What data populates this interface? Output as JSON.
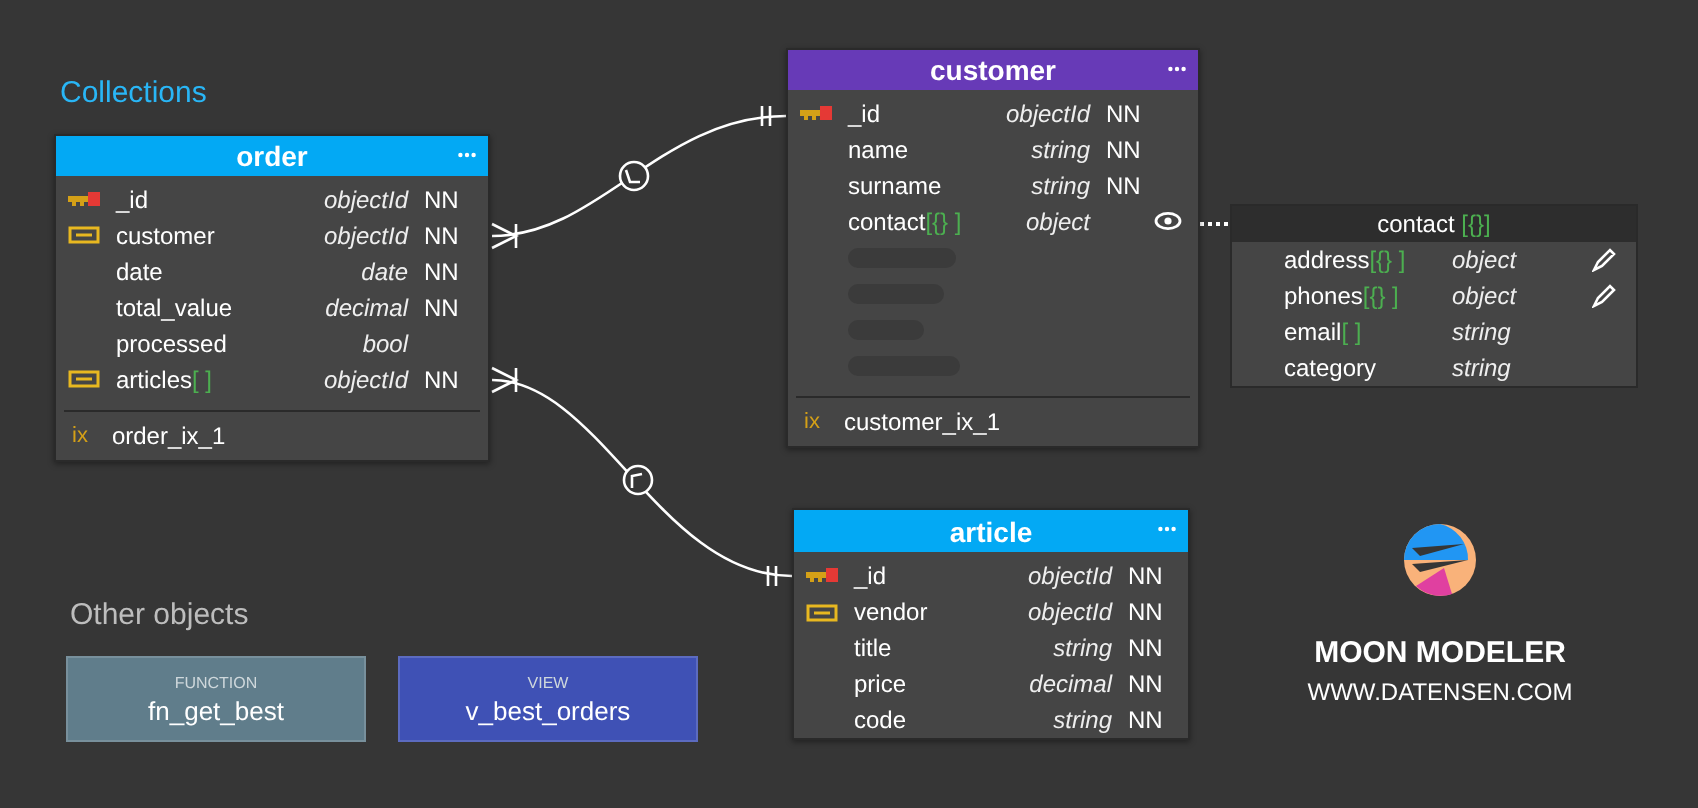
{
  "collections_label": "Collections",
  "tables": [
    {
      "name": "order",
      "color": "#03a9f4",
      "fields": [
        {
          "kind": "primary_key",
          "name": "_id",
          "type": "objectId",
          "nn": "NN"
        },
        {
          "kind": "foreign_key",
          "name": "customer",
          "type": "objectId",
          "nn": "NN"
        },
        {
          "kind": "plain",
          "name": "date",
          "type": "date",
          "nn": "NN"
        },
        {
          "kind": "plain",
          "name": "total_value",
          "type": "decimal",
          "nn": "NN"
        },
        {
          "kind": "plain",
          "name": "processed",
          "type": "bool"
        },
        {
          "kind": "foreign_key",
          "name": "articles",
          "suffix": "[ ]",
          "type": "objectId",
          "nn": "NN"
        }
      ],
      "indexes": [
        {
          "label": "ix",
          "name": "order_ix_1"
        }
      ]
    },
    {
      "name": "customer",
      "color": "#673ab7",
      "fields": [
        {
          "kind": "primary_key",
          "name": "_id",
          "type": "objectId",
          "nn": "NN"
        },
        {
          "kind": "plain",
          "name": "name",
          "type": "string",
          "nn": "NN"
        },
        {
          "kind": "plain",
          "name": "surname",
          "type": "string",
          "nn": "NN"
        },
        {
          "kind": "embedded",
          "name": "contact",
          "suffix": "[{} ]",
          "type": "object"
        }
      ],
      "indexes": [
        {
          "label": "ix",
          "name": "customer_ix_1"
        }
      ]
    },
    {
      "name": "article",
      "color": "#03a9f4",
      "fields": [
        {
          "kind": "primary_key",
          "name": "_id",
          "type": "objectId",
          "nn": "NN"
        },
        {
          "kind": "foreign_key",
          "name": "vendor",
          "type": "objectId",
          "nn": "NN"
        },
        {
          "kind": "plain",
          "name": "title",
          "type": "string",
          "nn": "NN"
        },
        {
          "kind": "plain",
          "name": "price",
          "type": "decimal",
          "nn": "NN"
        },
        {
          "kind": "plain",
          "name": "code",
          "type": "string",
          "nn": "NN"
        }
      ]
    }
  ],
  "subdocument": {
    "name": "contact",
    "suffix": "[{}]",
    "fields": [
      {
        "kind": "editable",
        "name": "address",
        "suffix": "[{} ]",
        "type": "object"
      },
      {
        "kind": "editable",
        "name": "phones",
        "suffix": "[{} ]",
        "type": "object"
      },
      {
        "kind": "plain",
        "name": "email",
        "suffix": "[ ]",
        "type": "string"
      },
      {
        "kind": "plain",
        "name": "category",
        "type": "string"
      }
    ]
  },
  "other_objects_label": "Other objects",
  "other_objects": [
    {
      "kind": "function",
      "label": "FUNCTION",
      "name": "fn_get_best"
    },
    {
      "kind": "view",
      "label": "VIEW",
      "name": "v_best_orders"
    }
  ],
  "brand": {
    "name": "MOON MODELER",
    "url": "WWW.DATENSEN.COM"
  }
}
